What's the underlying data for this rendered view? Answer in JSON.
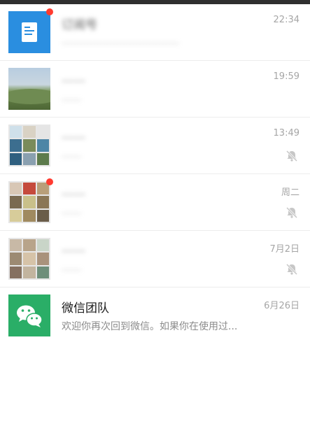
{
  "chats": [
    {
      "name": "订阅号",
      "preview": "………………………………",
      "time": "22:34",
      "avatar": "subscription-icon",
      "badge_dot": true,
      "muted": false,
      "blurred": true
    },
    {
      "name": "……",
      "preview": "……",
      "time": "19:59",
      "avatar": "landscape-photo",
      "badge_dot": false,
      "muted": false,
      "blurred": true
    },
    {
      "name": "……",
      "preview": "……",
      "time": "13:49",
      "avatar": "group-collage",
      "badge_dot": false,
      "muted": true,
      "blurred": true
    },
    {
      "name": "……",
      "preview": "……",
      "time": "周二",
      "avatar": "group-collage",
      "badge_dot": true,
      "muted": true,
      "blurred": true
    },
    {
      "name": "……",
      "preview": "……",
      "time": "7月2日",
      "avatar": "group-collage",
      "badge_dot": false,
      "muted": true,
      "blurred": true
    },
    {
      "name": "微信团队",
      "preview": "欢迎你再次回到微信。如果你在使用过...",
      "time": "6月26日",
      "avatar": "wechat-logo",
      "badge_dot": false,
      "muted": false,
      "blurred": false
    }
  ],
  "colors": {
    "accent_green": "#2aae67",
    "unread_dot": "#ff3b30",
    "subscription_blue": "#2a8ee0"
  }
}
